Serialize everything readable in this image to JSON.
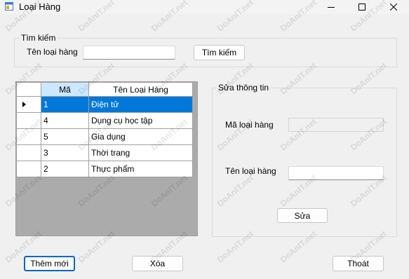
{
  "window": {
    "title": "Loại Hàng"
  },
  "search": {
    "group_title": "Tìm kiếm",
    "label": "Tên loại hàng",
    "value": "",
    "button": "Tìm kiếm"
  },
  "grid": {
    "columns": [
      "Mã",
      "Tên Loại Hàng"
    ],
    "rows": [
      {
        "id": "1",
        "name": "Điện tử",
        "selected": true
      },
      {
        "id": "4",
        "name": "Dụng cụ học tập",
        "selected": false
      },
      {
        "id": "5",
        "name": "Gia dụng",
        "selected": false
      },
      {
        "id": "3",
        "name": "Thời trang",
        "selected": false
      },
      {
        "id": "2",
        "name": "Thực phẩm",
        "selected": false
      }
    ]
  },
  "edit": {
    "group_title": "Sửa thông tin",
    "code_label": "Mã loại hàng",
    "code_value": "",
    "name_label": "Tên loại hàng",
    "name_value": "",
    "save_button": "Sửa"
  },
  "actions": {
    "add": "Thêm mới",
    "delete": "Xóa",
    "exit": "Thoát"
  },
  "watermark": "DoAnIT.net",
  "colors": {
    "selection": "#0078d7",
    "sorted_header": "#cce8ff",
    "default_button_border": "#0067c0"
  }
}
